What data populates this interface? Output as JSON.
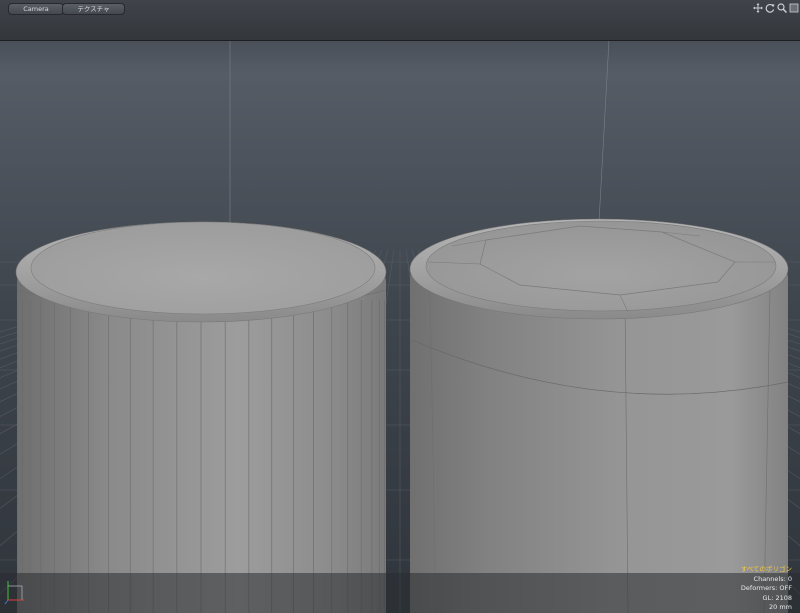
{
  "toolbar": {
    "camera_tab": "Camera",
    "texture_tab": "テクスチャ",
    "icons": [
      "move-icon",
      "rotate-icon",
      "zoom-icon",
      "maximize-icon"
    ]
  },
  "colors": {
    "background_top": "#545a63",
    "background_bottom": "#343a43",
    "object_gray": "#8e8e8e",
    "info_highlight": "#f0c940",
    "info_text": "#e9ecef"
  },
  "status": {
    "selection_mode": "すべてのポリゴン",
    "channels": "Channels: 0",
    "deformers": "Deformers: OFF",
    "gl": "GL: 2108",
    "focal": "20 mm"
  }
}
